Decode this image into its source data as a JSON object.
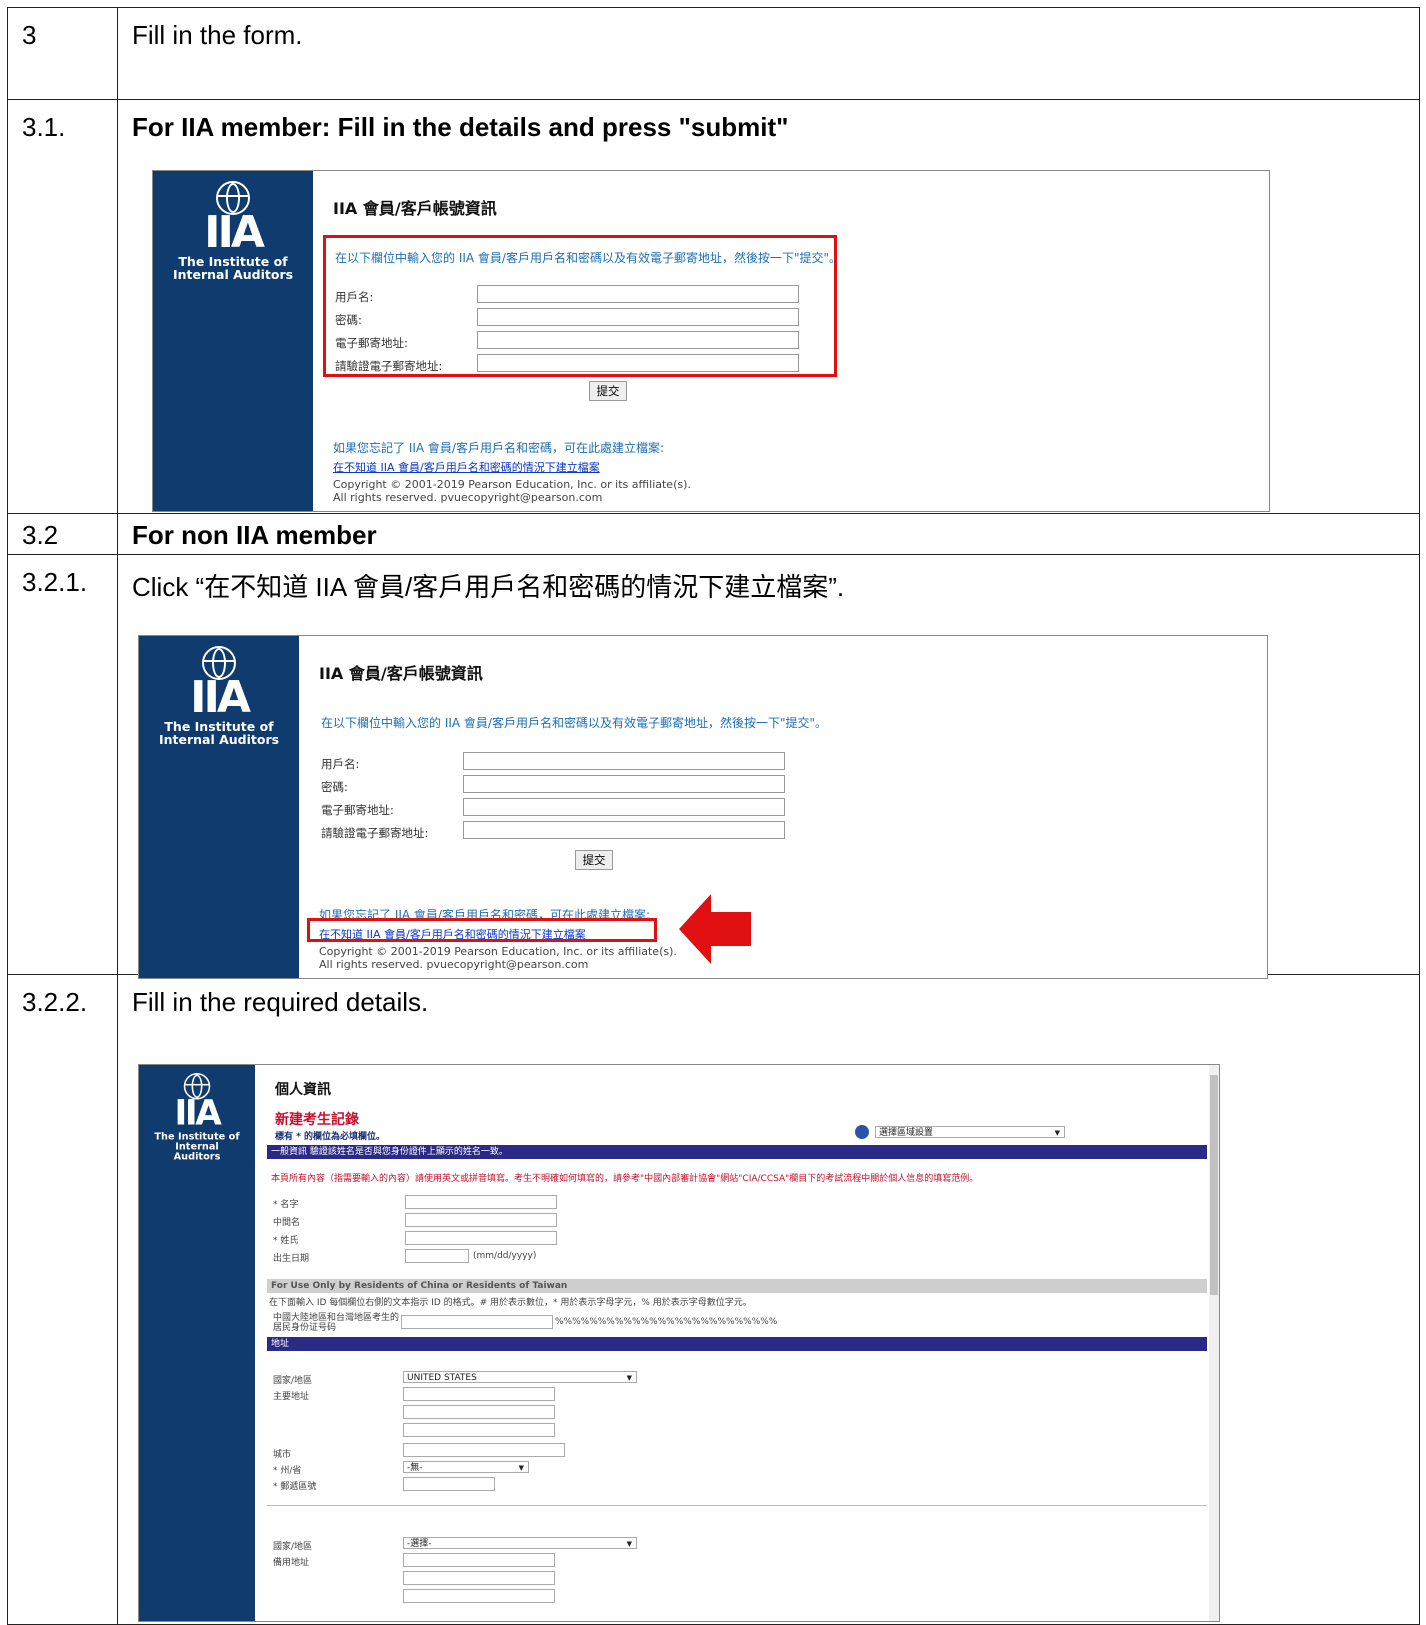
{
  "rows": {
    "r3": {
      "num": "3",
      "text": "Fill in the form."
    },
    "r31": {
      "num": "3.1.",
      "text": "For IIA member: Fill in the details and press \"submit\""
    },
    "r32": {
      "num": "3.2",
      "text": "For non IIA member"
    },
    "r321": {
      "num": "3.2.1.",
      "text": "Click “在不知道 IIA 會員/客戶用戶名和密碼的情況下建立檔案”."
    },
    "r322": {
      "num": "3.2.2.",
      "text": "Fill in the required details."
    }
  },
  "logo": {
    "mark": "IIA",
    "org_line1": "The Institute of",
    "org_line2": "Internal Auditors"
  },
  "login_form": {
    "title": "IIA 會員/客戶帳號資訊",
    "instruction": "在以下欄位中輸入您的 IIA 會員/客戶用戶名和密碼以及有效電子郵寄地址，然後按一下\"提交\"。",
    "username_label": "用戶名:",
    "password_label": "密碼:",
    "email_label": "電子郵寄地址:",
    "confirm_email_label": "請驗證電子郵寄地址:",
    "submit_label": "提交",
    "forgot_text": "如果您忘記了 IIA 會員/客戶用戶名和密碼，可在此處建立檔案:",
    "create_link": "在不知道 IIA 會員/客戶用戶名和密碼的情況下建立檔案",
    "copyright_line1": "Copyright © 2001-2019 Pearson Education, Inc. or its affiliate(s).",
    "copyright_line2": "All rights reserved. pvuecopyright@pearson.com"
  },
  "profile_form": {
    "heading": "個人資訊",
    "subheading": "新建考生記錄",
    "required_note": "標有 * 的欄位為必填欄位。",
    "locale_select": "選擇區域設置",
    "general_bar": "一般資訊  驗證該姓名是否與您身份證件上顯示的姓名一致。",
    "notice": "本頁所有內容（指需要輸入的內容）請使用英文或拼音填寫。考生不明確如何填寫的，請參考\"中國內部審計協會\"網站\"CIA/CCSA\"欄目下的考試流程中關於個人信息的填寫范例。",
    "first_name": "* 名字",
    "middle_name": "中間名",
    "last_name": "* 姓氏",
    "dob": "出生日期",
    "dob_hint": "(mm/dd/yyyy)",
    "residents_bar": "For Use Only by Residents of China or Residents of Taiwan",
    "id_note": "在下面輸入 ID 每個欄位右側的文本指示 ID 的格式。# 用於表示數位，* 用於表示字母字元，% 用於表示字母數位字元。",
    "id_label": "中國大陸地區和台灣地區考生的居民身份证号码",
    "id_format": "%%%%%%%%%%%%%%%%%%%%%%%%%%",
    "address_bar": "地址",
    "country_label": "國家/地區",
    "country_value": "UNITED STATES",
    "primary_address": "主要地址",
    "city": "城市",
    "state": "* 州/省",
    "state_value": "-無-",
    "postal": "* 郵遞區號",
    "country2_label": "國家/地區",
    "country2_value": "-選擇-",
    "alt_address": "備用地址"
  }
}
